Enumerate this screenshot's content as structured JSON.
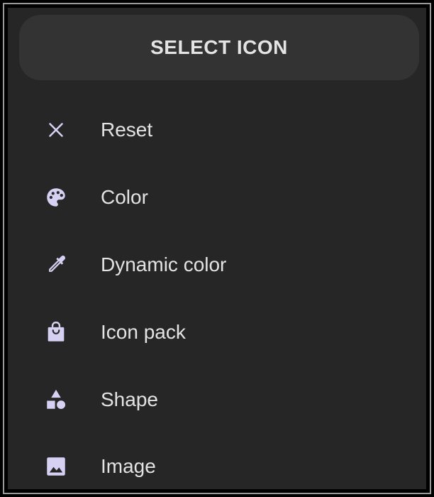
{
  "header": {
    "title": "SELECT ICON"
  },
  "colors": {
    "icon_tint": "#d6d0f2",
    "label_text": "#e3e3e3",
    "panel_bg": "#262626",
    "header_bg": "#333333"
  },
  "menu": {
    "items": [
      {
        "label": "Reset",
        "icon": "close-icon"
      },
      {
        "label": "Color",
        "icon": "palette-icon"
      },
      {
        "label": "Dynamic color",
        "icon": "eyedropper-icon"
      },
      {
        "label": "Icon pack",
        "icon": "shopping-bag-icon"
      },
      {
        "label": "Shape",
        "icon": "shapes-icon"
      },
      {
        "label": "Image",
        "icon": "image-icon"
      }
    ]
  }
}
